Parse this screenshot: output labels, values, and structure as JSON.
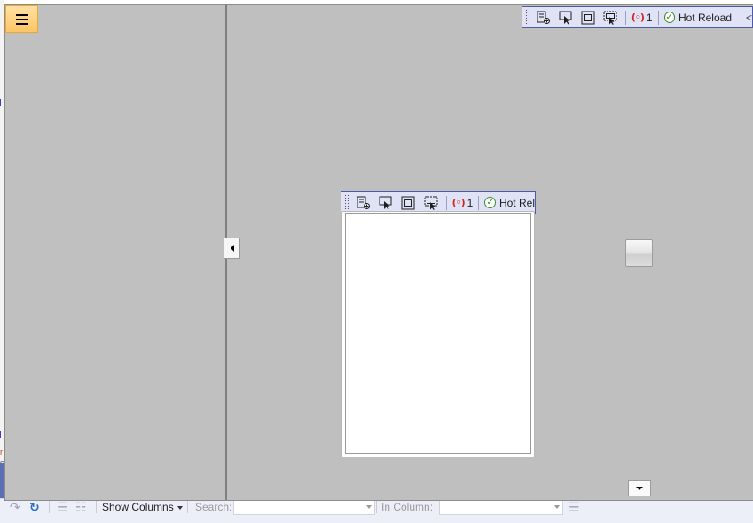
{
  "runtime_toolbar": {
    "error_count": "1",
    "hot_reload_label": "Hot Reload",
    "hot_reload_label_truncated": "Hot Rel",
    "collapse_glyph": "<"
  },
  "icons": {
    "menu": "hamburger-icon",
    "live_tree": "live-visual-tree-icon",
    "select_element": "select-element-icon",
    "display_adorners": "display-adorners-icon",
    "track_focus": "track-focus-icon",
    "binding_errors": "binding-errors-icon",
    "hot_reload_status": "check-circle-icon"
  },
  "ide_toolbar": {
    "show_columns": "Show Columns",
    "search_label": "Search:",
    "search_value": "",
    "in_column_label": "In Column:",
    "in_column_value": ""
  },
  "ide_fragments": {
    "left_top": "r",
    "left_bottom": "s"
  },
  "colors": {
    "app_background": "#bfbfbf",
    "toolbar_background": "#dfe3f5",
    "toolbar_border": "#4c5aa8",
    "hamburger_fill": "#fcc566",
    "error_red": "#d0271d",
    "ok_green": "#3a8f2d"
  }
}
